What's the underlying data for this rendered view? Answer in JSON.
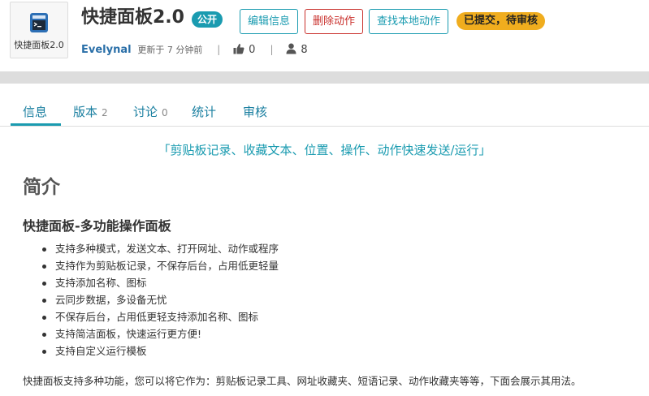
{
  "app": {
    "icon_label": "快捷面板2.0",
    "title": "快捷面板2.0",
    "visibility_badge": "公开",
    "buttons": {
      "edit": "编辑信息",
      "delete": "删除动作",
      "find_local": "查找本地动作"
    },
    "status": "已提交，待审核",
    "author": "Evelynal",
    "updated": "更新于 7 分钟前",
    "likes": "0",
    "users": "8"
  },
  "tabs": [
    {
      "label": "信息",
      "count": ""
    },
    {
      "label": "版本",
      "count": "2"
    },
    {
      "label": "讨论",
      "count": "0"
    },
    {
      "label": "统计",
      "count": ""
    },
    {
      "label": "审核",
      "count": ""
    }
  ],
  "content": {
    "tagline": "「剪贴板记录、收藏文本、位置、操作、动作快速发送/运行」",
    "section_title": "简介",
    "subtitle": "快捷面板-多功能操作面板",
    "features": [
      "支持多种模式，发送文本、打开网址、动作或程序",
      "支持作为剪贴板记录，不保存后台，占用低更轻量",
      "支持添加名称、图标",
      "云同步数据，多设备无忧",
      "不保存后台，占用低更轻支持添加名称、图标",
      "支持简洁面板，快速运行更方便!",
      "支持自定义运行模板"
    ],
    "description": "快捷面板支持多种功能，您可以将它作为：剪贴板记录工具、网址收藏夹、短语记录、动作收藏夹等等，下面会展示其用法。"
  },
  "colors": {
    "accent": "#1a9bb0",
    "danger": "#c9302c",
    "warning": "#f0ad1e",
    "link": "#2a6fa8"
  },
  "icons": [
    "app-window-icon",
    "thumbs-up-icon",
    "user-icon"
  ]
}
